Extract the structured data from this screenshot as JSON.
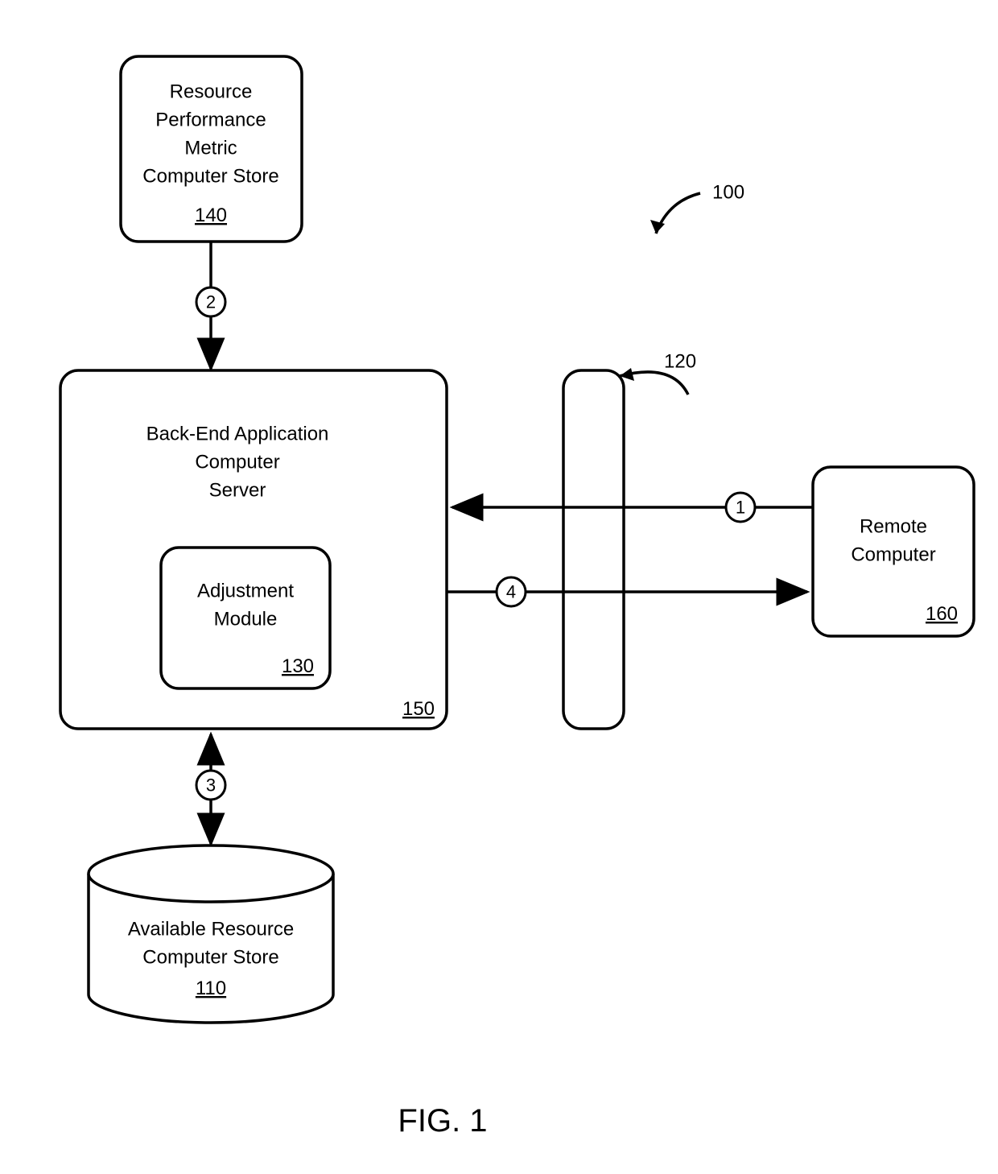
{
  "figure": {
    "caption": "FIG. 1",
    "reference": "100"
  },
  "boxes": {
    "resource_metric_store": {
      "line1": "Resource",
      "line2": "Performance",
      "line3": "Metric",
      "line4": "Computer Store",
      "ref": "140"
    },
    "backend_server": {
      "line1": "Back-End Application",
      "line2": "Computer",
      "line3": "Server",
      "ref": "150"
    },
    "adjustment_module": {
      "line1": "Adjustment",
      "line2": "Module",
      "ref": "130"
    },
    "available_resource_store": {
      "line1": "Available Resource",
      "line2": "Computer Store",
      "ref": "110"
    },
    "remote_computer": {
      "line1": "Remote",
      "line2": "Computer",
      "ref": "160"
    },
    "firewall": {
      "ref": "120"
    }
  },
  "step_labels": {
    "s1": "1",
    "s2": "2",
    "s3": "3",
    "s4": "4"
  }
}
